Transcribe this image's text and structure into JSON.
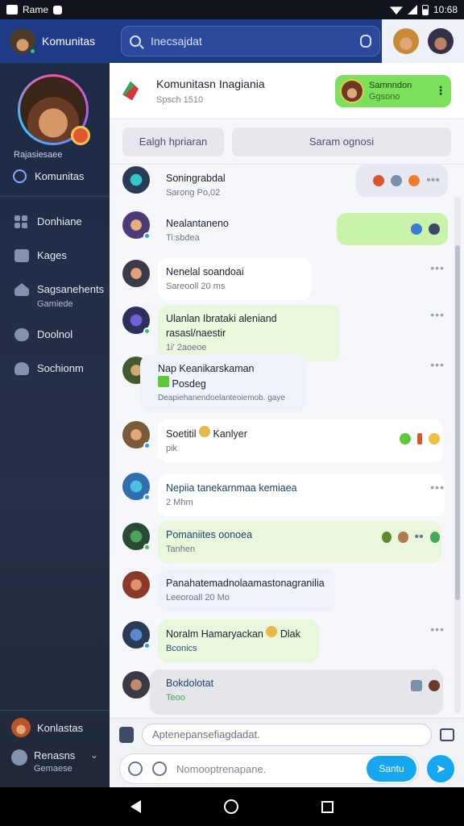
{
  "status_bar": {
    "app_name": "Rame",
    "time": "10:68"
  },
  "top_bar": {
    "app_title": "Komunitas",
    "search_placeholder": "Inecsajdat"
  },
  "sidebar": {
    "username": "Rajasiesaee",
    "community_label": "Komunitas",
    "items": [
      {
        "label": "Donhiane",
        "sub": ""
      },
      {
        "label": "Kages",
        "sub": ""
      },
      {
        "label": "Sagsanehents",
        "sub": "Gamiede"
      },
      {
        "label": "Doolnol",
        "sub": ""
      },
      {
        "label": "Sochionm",
        "sub": ""
      }
    ],
    "bottom": {
      "label1": "Konlastas",
      "label2": "Renasns",
      "sub2": "Gemaese"
    }
  },
  "channel": {
    "title": "Komunitasn Inagiania",
    "subtitle": "Spsch 1510",
    "join_title": "Samnndon",
    "join_sub": "Ggsono"
  },
  "tabs": [
    "Ealgh hpriaran",
    "Saram ognosi"
  ],
  "messages": [
    {
      "title": "Soningrabdal",
      "sub": "Sarong Po,02"
    },
    {
      "title": "Nealantaneno",
      "sub": "Ti:sbdea"
    },
    {
      "title": "Nenelal soandoai",
      "sub": "Sareooll 20 ms"
    },
    {
      "title": "Ulanlan Ibrataki aleniand rasasl/naestir",
      "sub": "1i' 2aoeoe"
    },
    {
      "title": "Nap Keanikarskaman",
      "line2": "Posdeg",
      "sub": "Deapiehanendoelanteoiemob. gaye"
    },
    {
      "title": "Soetitil",
      "title_tail": "Kanlyer",
      "sub": "pik"
    },
    {
      "title": "Nepiia tanekarnmaa kemiaea",
      "sub": "2 Mhm"
    },
    {
      "title": "Pomaniites oonoea",
      "sub": "Tanhen"
    },
    {
      "title": "Panahatemadnolaamastonagranilia",
      "sub": "Leeoroall 20 Mo"
    },
    {
      "title": "Noralm Hamaryackan",
      "title_tail": "Dlak",
      "sub": "Bconics"
    },
    {
      "title": "Bokdolotat",
      "sub": "Teoo"
    }
  ],
  "composer": {
    "placeholder1": "Aptenepansefiagdadat.",
    "placeholder2": "Nomooptrenapane.",
    "send_label": "Santu"
  },
  "colors": {
    "accent": "#17A7F1",
    "topbar": "#1F3A86",
    "green": "#7BE05A",
    "sidebar": "#273148"
  }
}
